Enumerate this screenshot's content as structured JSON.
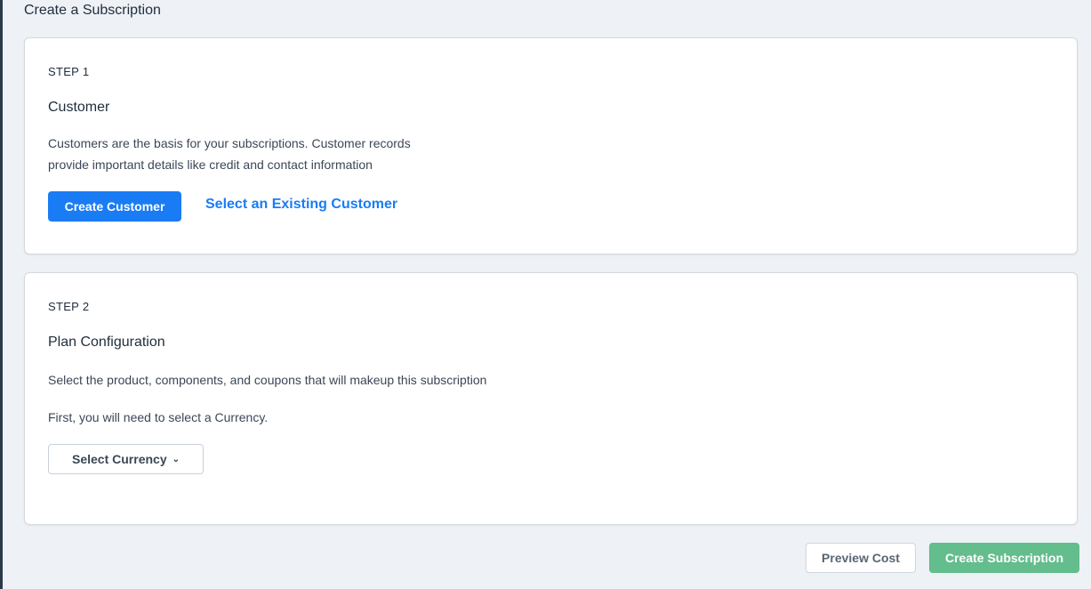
{
  "page": {
    "title": "Create a Subscription"
  },
  "step1": {
    "step_label": "STEP 1",
    "heading": "Customer",
    "description_line1": "Customers are the basis for your subscriptions. Customer records",
    "description_line2": "provide important details like credit and contact information",
    "create_button": "Create Customer",
    "select_link": "Select an Existing Customer"
  },
  "step2": {
    "step_label": "STEP 2",
    "heading": "Plan Configuration",
    "description": "Select the product, components, and coupons that will makeup this subscription",
    "currency_note": "First, you will need to select a Currency.",
    "currency_button": "Select Currency",
    "currency_icon": "chevron-down-icon"
  },
  "footer": {
    "preview_button": "Preview Cost",
    "create_button": "Create Subscription"
  },
  "colors": {
    "primary": "#1a7cf5",
    "success": "#63bd8c",
    "background": "#eef1f5"
  }
}
